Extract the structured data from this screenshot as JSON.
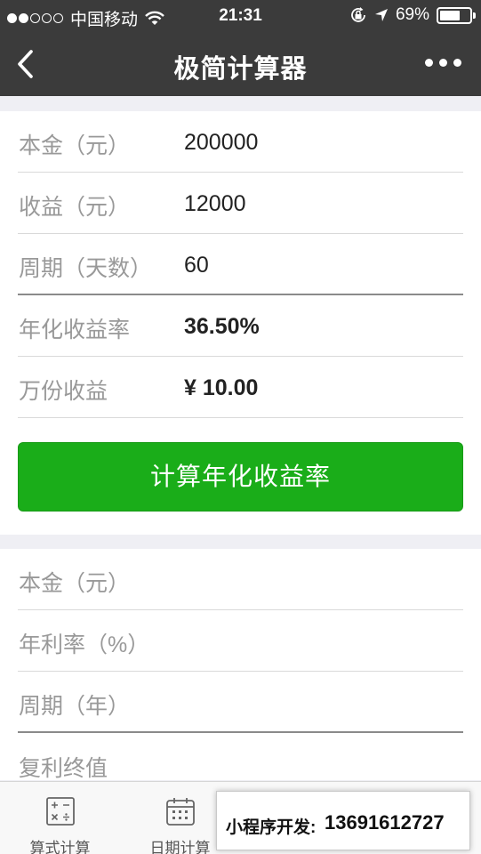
{
  "status_bar": {
    "carrier": "中国移动",
    "time": "21:31",
    "battery_percent": "69%",
    "battery_level": 0.69
  },
  "nav": {
    "title": "极简计算器"
  },
  "yield_card": {
    "rows": [
      {
        "label": "本金（元）",
        "value": "200000"
      },
      {
        "label": "收益（元）",
        "value": "12000"
      },
      {
        "label": "周期（天数）",
        "value": "60"
      },
      {
        "label": "年化收益率",
        "value": "36.50%"
      },
      {
        "label": "万份收益",
        "value": "¥ 10.00"
      }
    ],
    "button_label": "计算年化收益率"
  },
  "compound_card": {
    "rows": [
      {
        "label": "本金（元）",
        "value": ""
      },
      {
        "label": "年利率（%）",
        "value": ""
      },
      {
        "label": "周期（年）",
        "value": ""
      },
      {
        "label": "复利终值",
        "value": ""
      }
    ]
  },
  "tabbar": {
    "tabs": [
      {
        "label": "算式计算",
        "icon": "calculator-icon"
      },
      {
        "label": "日期计算",
        "icon": "calendar-icon"
      },
      {
        "label": "",
        "icon": "finance-icon"
      },
      {
        "label": "",
        "icon": "more-icon"
      }
    ]
  },
  "ad_banner": {
    "label": "小程序开发:",
    "phone": "13691612727"
  },
  "colors": {
    "nav_bg": "#3b3b3b",
    "accent_green": "#1aad19"
  }
}
